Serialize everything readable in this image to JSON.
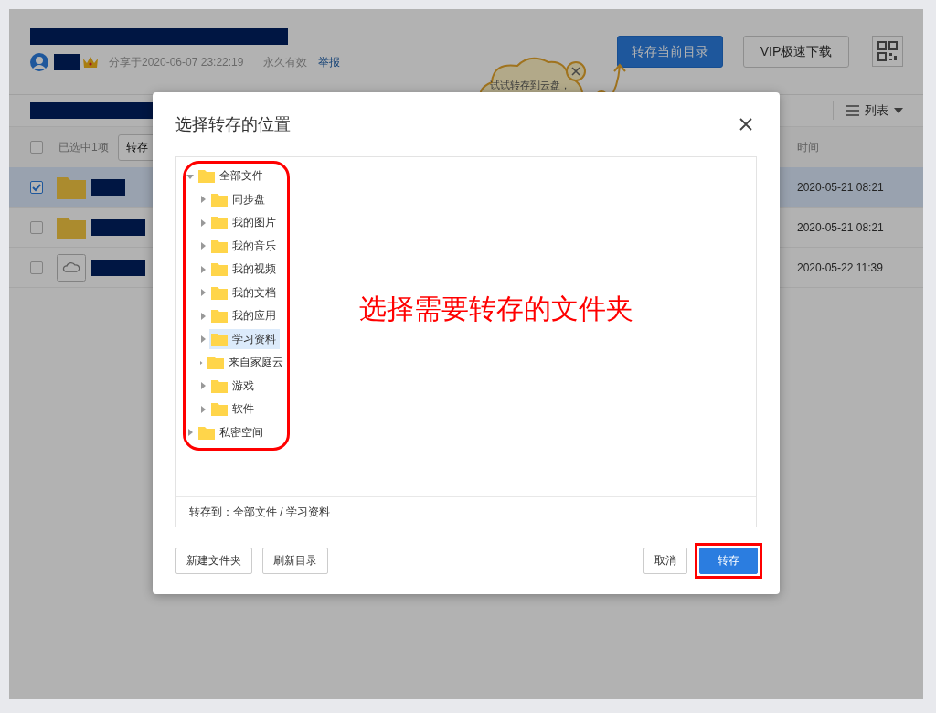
{
  "header": {
    "share_info": "分享于2020-06-07 23:22:19",
    "validity": "永久有效",
    "report_link": "举报",
    "buttons": [
      {
        "label": "转存当前目录",
        "kind": "primary"
      },
      {
        "label": "VIP极速下载",
        "kind": "default"
      }
    ]
  },
  "tip_bubble": "试试转存到云盘，",
  "view_switch": "列表",
  "toolbar": {
    "all_checked": false,
    "selection_count": "已选中1项",
    "action_button": "转存"
  },
  "table": {
    "columns": [
      "时间"
    ],
    "rows": [
      {
        "kind": "folder",
        "checked": true,
        "selected": true,
        "time": "2020-05-21 08:21"
      },
      {
        "kind": "folder",
        "checked": false,
        "selected": false,
        "time": "2020-05-21 08:21"
      },
      {
        "kind": "cloud",
        "checked": false,
        "selected": false,
        "time": "2020-05-22 11:39"
      }
    ]
  },
  "dialog": {
    "title": "选择转存的位置",
    "tree": [
      {
        "label": "全部文件",
        "expanded": true,
        "selected": false,
        "children": [
          {
            "label": "同步盘",
            "expanded": false,
            "selected": false
          },
          {
            "label": "我的图片",
            "expanded": false,
            "selected": false
          },
          {
            "label": "我的音乐",
            "expanded": false,
            "selected": false
          },
          {
            "label": "我的视频",
            "expanded": false,
            "selected": false
          },
          {
            "label": "我的文档",
            "expanded": false,
            "selected": false
          },
          {
            "label": "我的应用",
            "expanded": false,
            "selected": false
          },
          {
            "label": "学习资料",
            "expanded": false,
            "selected": true
          },
          {
            "label": "来自家庭云",
            "expanded": false,
            "selected": false
          },
          {
            "label": "游戏",
            "expanded": false,
            "selected": false
          },
          {
            "label": "软件",
            "expanded": false,
            "selected": false
          }
        ]
      },
      {
        "label": "私密空间",
        "expanded": false,
        "selected": false
      }
    ],
    "destination": "转存到：全部文件 / 学习资料",
    "left_buttons": [
      "新建文件夹",
      "刷新目录"
    ],
    "right_buttons": [
      {
        "label": "取消",
        "kind": "default"
      },
      {
        "label": "转存",
        "kind": "primary",
        "highlighted": true
      }
    ]
  },
  "annotation": "选择需要转存的文件夹"
}
